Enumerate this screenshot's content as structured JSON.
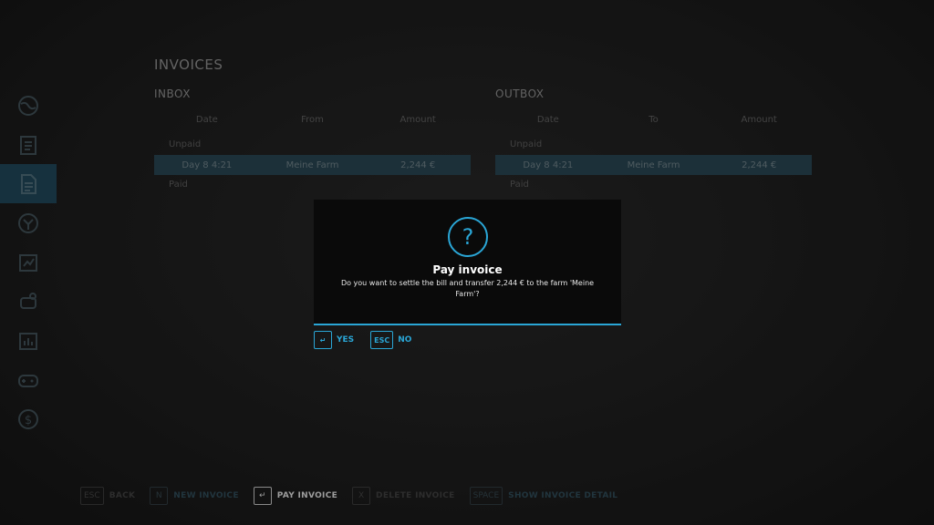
{
  "page": {
    "title": "INVOICES"
  },
  "sidebar": {
    "items": [
      {
        "icon": "globe-icon",
        "active": false
      },
      {
        "icon": "clipboard-icon",
        "active": false
      },
      {
        "icon": "invoice-icon",
        "active": true
      },
      {
        "icon": "mission-icon",
        "active": false
      },
      {
        "icon": "chart-icon",
        "active": false
      },
      {
        "icon": "animal-icon",
        "active": false
      },
      {
        "icon": "statistics-icon",
        "active": false
      },
      {
        "icon": "gamepad-icon",
        "active": false
      },
      {
        "icon": "finance-icon",
        "active": false
      }
    ]
  },
  "inbox": {
    "title": "INBOX",
    "columns": [
      "Date",
      "From",
      "Amount"
    ],
    "group_label": "Unpaid",
    "selected_row": [
      "Day 8 4:21",
      "Meine Farm",
      "2,244 €"
    ],
    "footer_label": "Paid"
  },
  "outbox": {
    "title": "OUTBOX",
    "columns": [
      "Date",
      "To",
      "Amount"
    ],
    "group_label": "Unpaid",
    "selected_row": [
      "Day 8 4:21",
      "Meine Farm",
      "2,244 €"
    ],
    "footer_label": "Paid"
  },
  "bottom_bar": {
    "back": {
      "key": "ESC",
      "label": "BACK"
    },
    "new_invoice": {
      "key": "N",
      "label": "NEW INVOICE"
    },
    "pay_invoice": {
      "key": "↵",
      "label": "PAY INVOICE"
    },
    "delete_invoice": {
      "key": "X",
      "label": "DELETE INVOICE"
    },
    "show_details": {
      "key": "SPACE",
      "label": "SHOW INVOICE DETAIL"
    }
  },
  "dialog": {
    "icon": "question-icon",
    "icon_glyph": "?",
    "title": "Pay invoice",
    "message": "Do you want to settle the bill and transfer 2,244 € to the farm 'Meine Farm'?",
    "yes": {
      "key": "↵",
      "label": "YES"
    },
    "no": {
      "key": "ESC",
      "label": "NO"
    }
  },
  "colors": {
    "accent": "#2aa6d6",
    "dialog_bg": "#0a0a0a",
    "selected_row": "#27434f"
  }
}
